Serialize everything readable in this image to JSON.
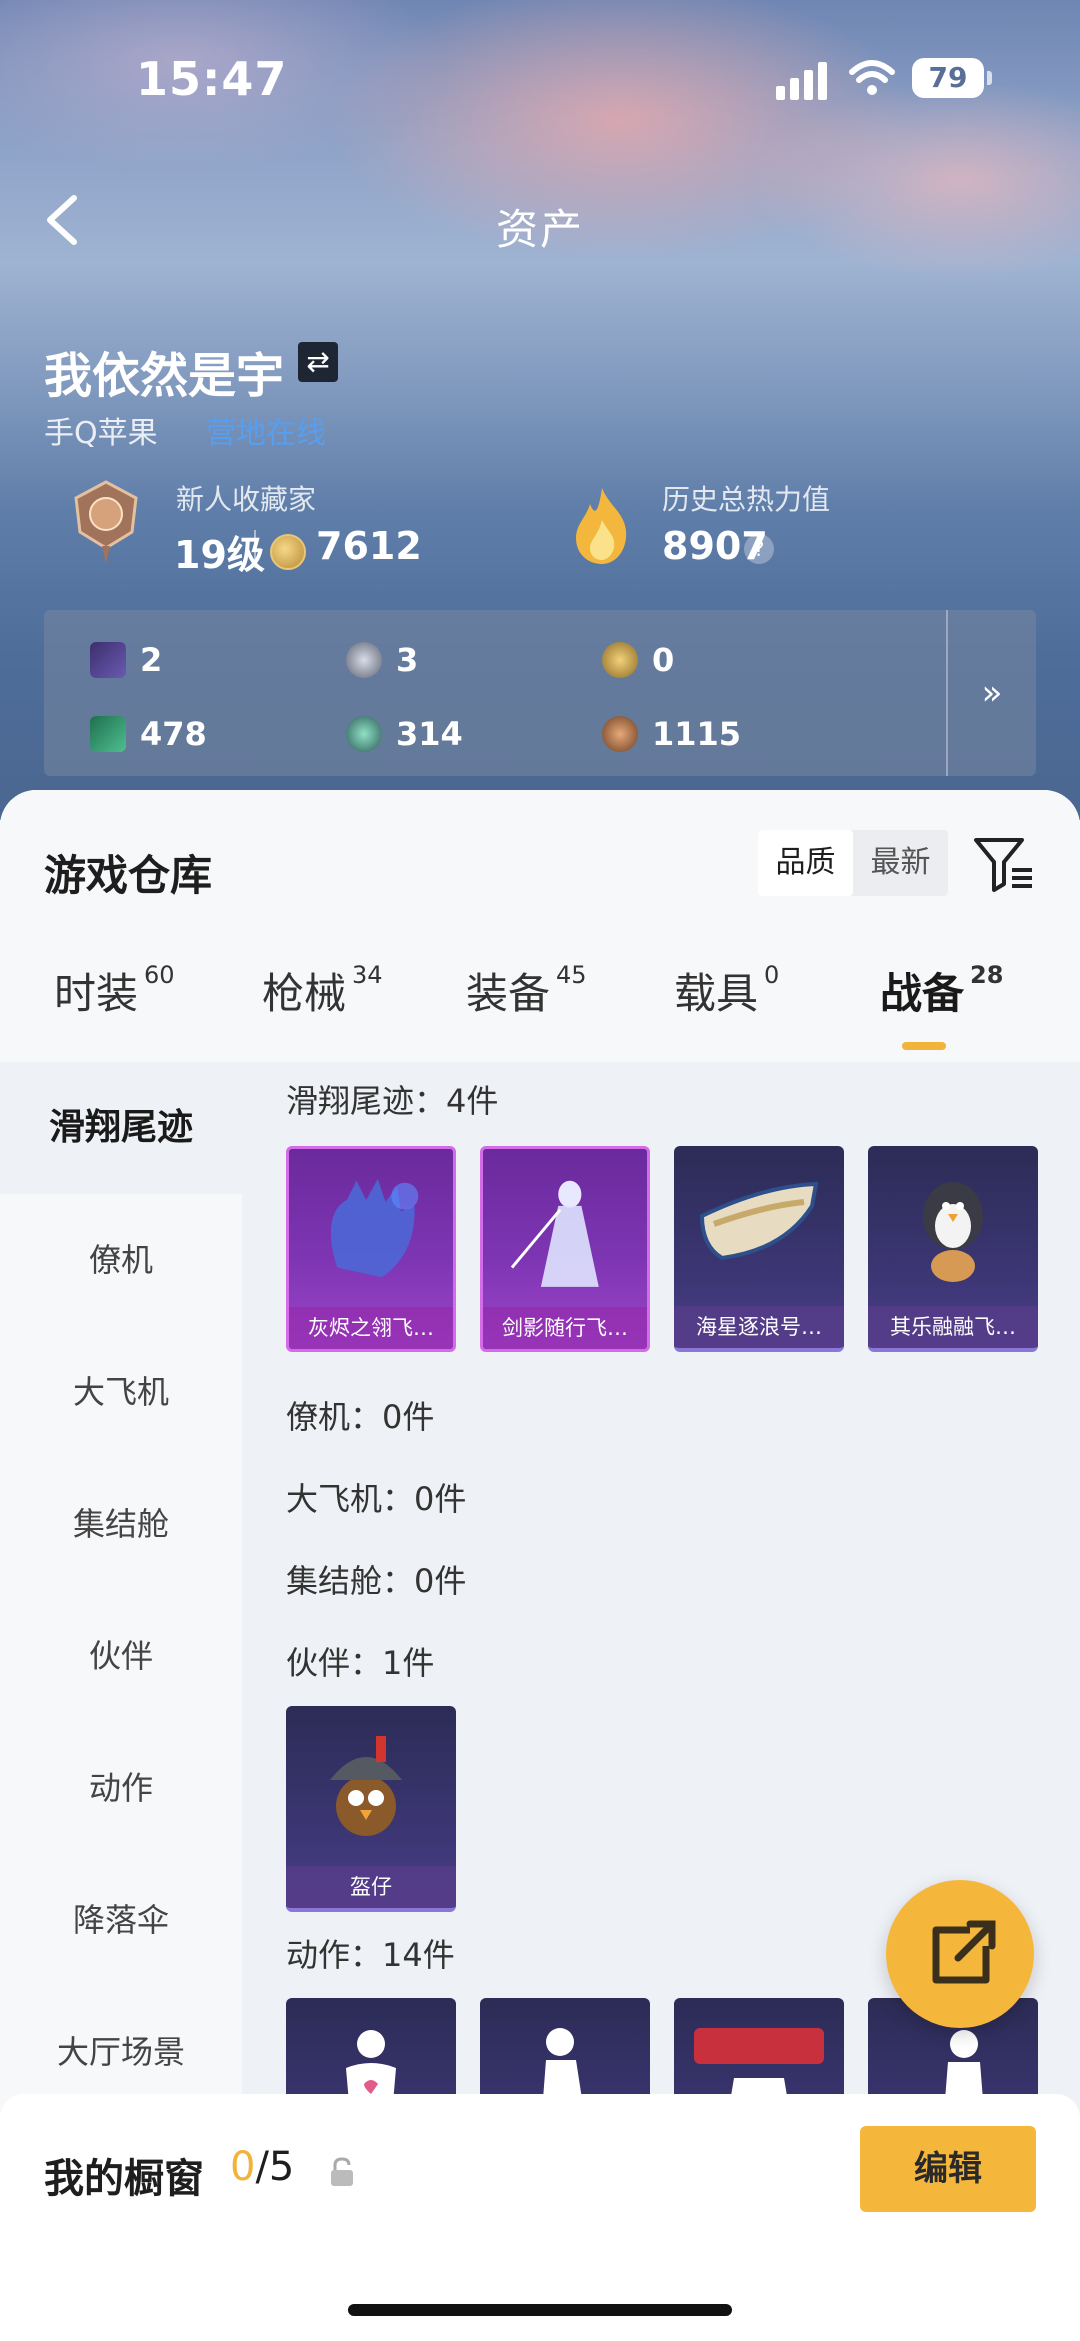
{
  "status_bar": {
    "time": "15:47",
    "battery": "79"
  },
  "header": {
    "title": "资产"
  },
  "profile": {
    "name": "我依然是宇",
    "platform": "手Q苹果",
    "platform_link": "营地在线",
    "rank_title": "新人收藏家",
    "level": "19级",
    "points": "7612",
    "heat_label": "历史总热力值",
    "heat_value": "8907"
  },
  "currencies": [
    {
      "icon": "purple-card-icon",
      "value": "2"
    },
    {
      "icon": "silver-coin-icon",
      "value": "3"
    },
    {
      "icon": "gold-coin-icon",
      "value": "0"
    },
    {
      "icon": "green-ticket-icon",
      "value": "478"
    },
    {
      "icon": "teal-orb-icon",
      "value": "314"
    },
    {
      "icon": "bronze-orb-icon",
      "value": "1115"
    }
  ],
  "warehouse": {
    "title": "游戏仓库",
    "sort_options": [
      "品质",
      "最新"
    ],
    "active_sort": "品质",
    "tabs": [
      {
        "label": "时装",
        "count": "60"
      },
      {
        "label": "枪械",
        "count": "34"
      },
      {
        "label": "装备",
        "count": "45"
      },
      {
        "label": "载具",
        "count": "0"
      },
      {
        "label": "战备",
        "count": "28"
      }
    ],
    "active_tab": "战备"
  },
  "sidebar": {
    "items": [
      "滑翔尾迹",
      "僚机",
      "大飞机",
      "集结舱",
      "伙伴",
      "动作",
      "降落伞",
      "大厅场景"
    ],
    "active": "滑翔尾迹"
  },
  "sections": {
    "glide": {
      "title": "滑翔尾迹：4件",
      "items": [
        "灰烬之翎飞…",
        "剑影随行飞…",
        "海星逐浪号…",
        "其乐融融飞…"
      ]
    },
    "wingman": {
      "title": "僚机：0件"
    },
    "plane": {
      "title": "大飞机：0件"
    },
    "pod": {
      "title": "集结舱：0件"
    },
    "partner": {
      "title": "伙伴：1件",
      "items": [
        "盔仔"
      ]
    },
    "emote": {
      "title": "动作：14件"
    }
  },
  "bottom": {
    "showcase_label": "我的橱窗",
    "showcase_current": "0",
    "showcase_total": "/5",
    "edit_label": "编辑"
  },
  "colors": {
    "accent": "#f5b73b",
    "link": "#4fa3ff",
    "purple_rarity": "#d46be8"
  }
}
